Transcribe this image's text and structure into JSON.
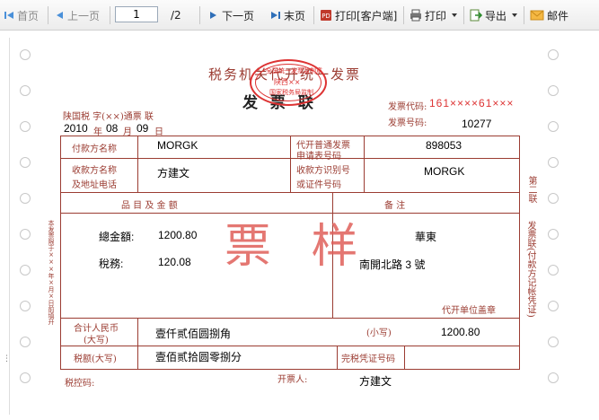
{
  "toolbar": {
    "first_page": "首页",
    "prev_page": "上一页",
    "current_page": "1",
    "total_pages": "/2",
    "next_page": "下一页",
    "last_page": "末页",
    "print_client": "打印[客户端]",
    "print": "打印",
    "export": "导出",
    "mail": "邮件"
  },
  "invoice": {
    "title": "税务机关代开统一发票",
    "subtitle": "发 票 联",
    "stamp": {
      "top": "全国统一发票监制章",
      "middle": "陕西××",
      "bottom": "国家税务局监制"
    },
    "code_label": "发票代码:",
    "code_value": "161××××61×××",
    "number_label": "发票号码:",
    "number_value": "10277",
    "issuer_line": "陕国税  字(××)通票  联",
    "date": {
      "year": "2010",
      "year_label": "年",
      "month": "08",
      "month_label": "月",
      "day": "09",
      "day_label": "日"
    },
    "payer_label": "付款方名称",
    "payer_value": "MORGK",
    "app_no_label_1": "代开普通发票",
    "app_no_label_2": "申请表号码",
    "app_no_value": "898053",
    "payee_label_1": "收款方名称",
    "payee_label_2": "及地址电话",
    "payee_value": "方建文",
    "payee_id_label_1": "收款方识别号",
    "payee_id_label_2": "或证件号码",
    "payee_id_value": "MORGK",
    "items_header": "品    目    及    金    额",
    "notes_header": "备        注",
    "total_amount_label": "總金額:",
    "total_amount_value": "1200.80",
    "tax_label": "稅務:",
    "tax_value": "120.08",
    "notes_line1": "華東",
    "notes_line2": "南開北路 3 號",
    "watermark": "票 样",
    "seal_note": "代开单位盖章",
    "total_rmb_label_1": "合计人民币",
    "total_rmb_label_2": "(大写)",
    "total_rmb_upper": "壹仟贰佰圆捌角",
    "small_label": "(小写)",
    "small_value": "1200.80",
    "tax_upper_label": "税额(大写)",
    "tax_upper_value": "壹佰贰拾圆零捌分",
    "tax_voucher_label": "完税凭证号码",
    "tax_controller_label": "税控码:",
    "issuer_person_label": "开票人:",
    "issuer_person_value": "方建文",
    "left_vertical": "本发票限于×××年×月×日前填开",
    "right_vertical_1": "第二联",
    "right_vertical_2": "发票联(付款方记帐凭证)"
  }
}
